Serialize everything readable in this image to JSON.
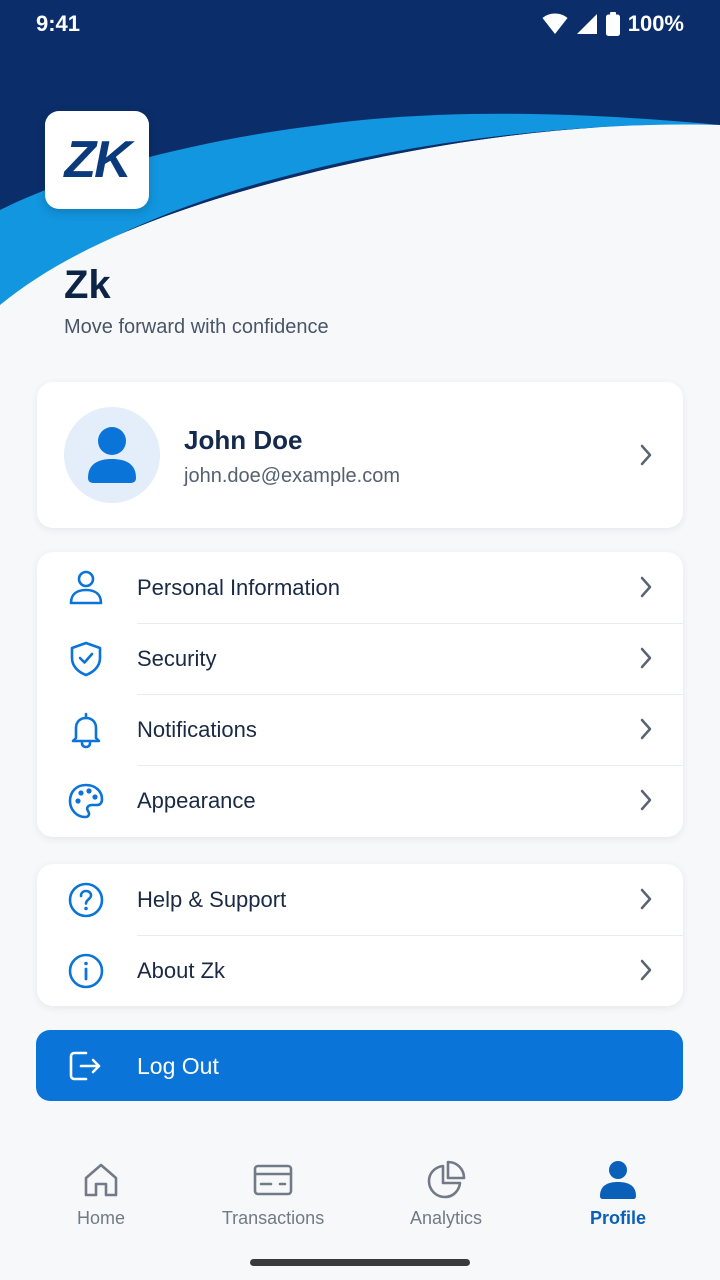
{
  "status_bar": {
    "time": "9:41",
    "battery": "100%"
  },
  "brand": {
    "logo_text": "ZK",
    "app_name": "Zk",
    "tagline": "Move forward with confidence"
  },
  "profile": {
    "name": "John Doe",
    "email": "john.doe@example.com",
    "icon": "user-avatar-icon"
  },
  "menu_main": [
    {
      "label": "Personal Information",
      "icon": "person-icon"
    },
    {
      "label": "Security",
      "icon": "shield-check-icon"
    },
    {
      "label": "Notifications",
      "icon": "bell-icon"
    },
    {
      "label": "Appearance",
      "icon": "palette-icon"
    }
  ],
  "menu_support": [
    {
      "label": "Help & Support",
      "icon": "help-circle-icon"
    },
    {
      "label": "About Zk",
      "icon": "info-circle-icon"
    }
  ],
  "logout": {
    "label": "Log Out",
    "icon": "logout-icon"
  },
  "nav": [
    {
      "label": "Home",
      "icon": "home-icon",
      "active": false
    },
    {
      "label": "Transactions",
      "icon": "card-icon",
      "active": false
    },
    {
      "label": "Analytics",
      "icon": "pie-chart-icon",
      "active": false
    },
    {
      "label": "Profile",
      "icon": "profile-icon",
      "active": true
    }
  ],
  "colors": {
    "header_dark": "#0b2e6b",
    "header_wave": "#1296e0",
    "accent": "#0a74d9",
    "active_nav": "#0a5fb8"
  }
}
